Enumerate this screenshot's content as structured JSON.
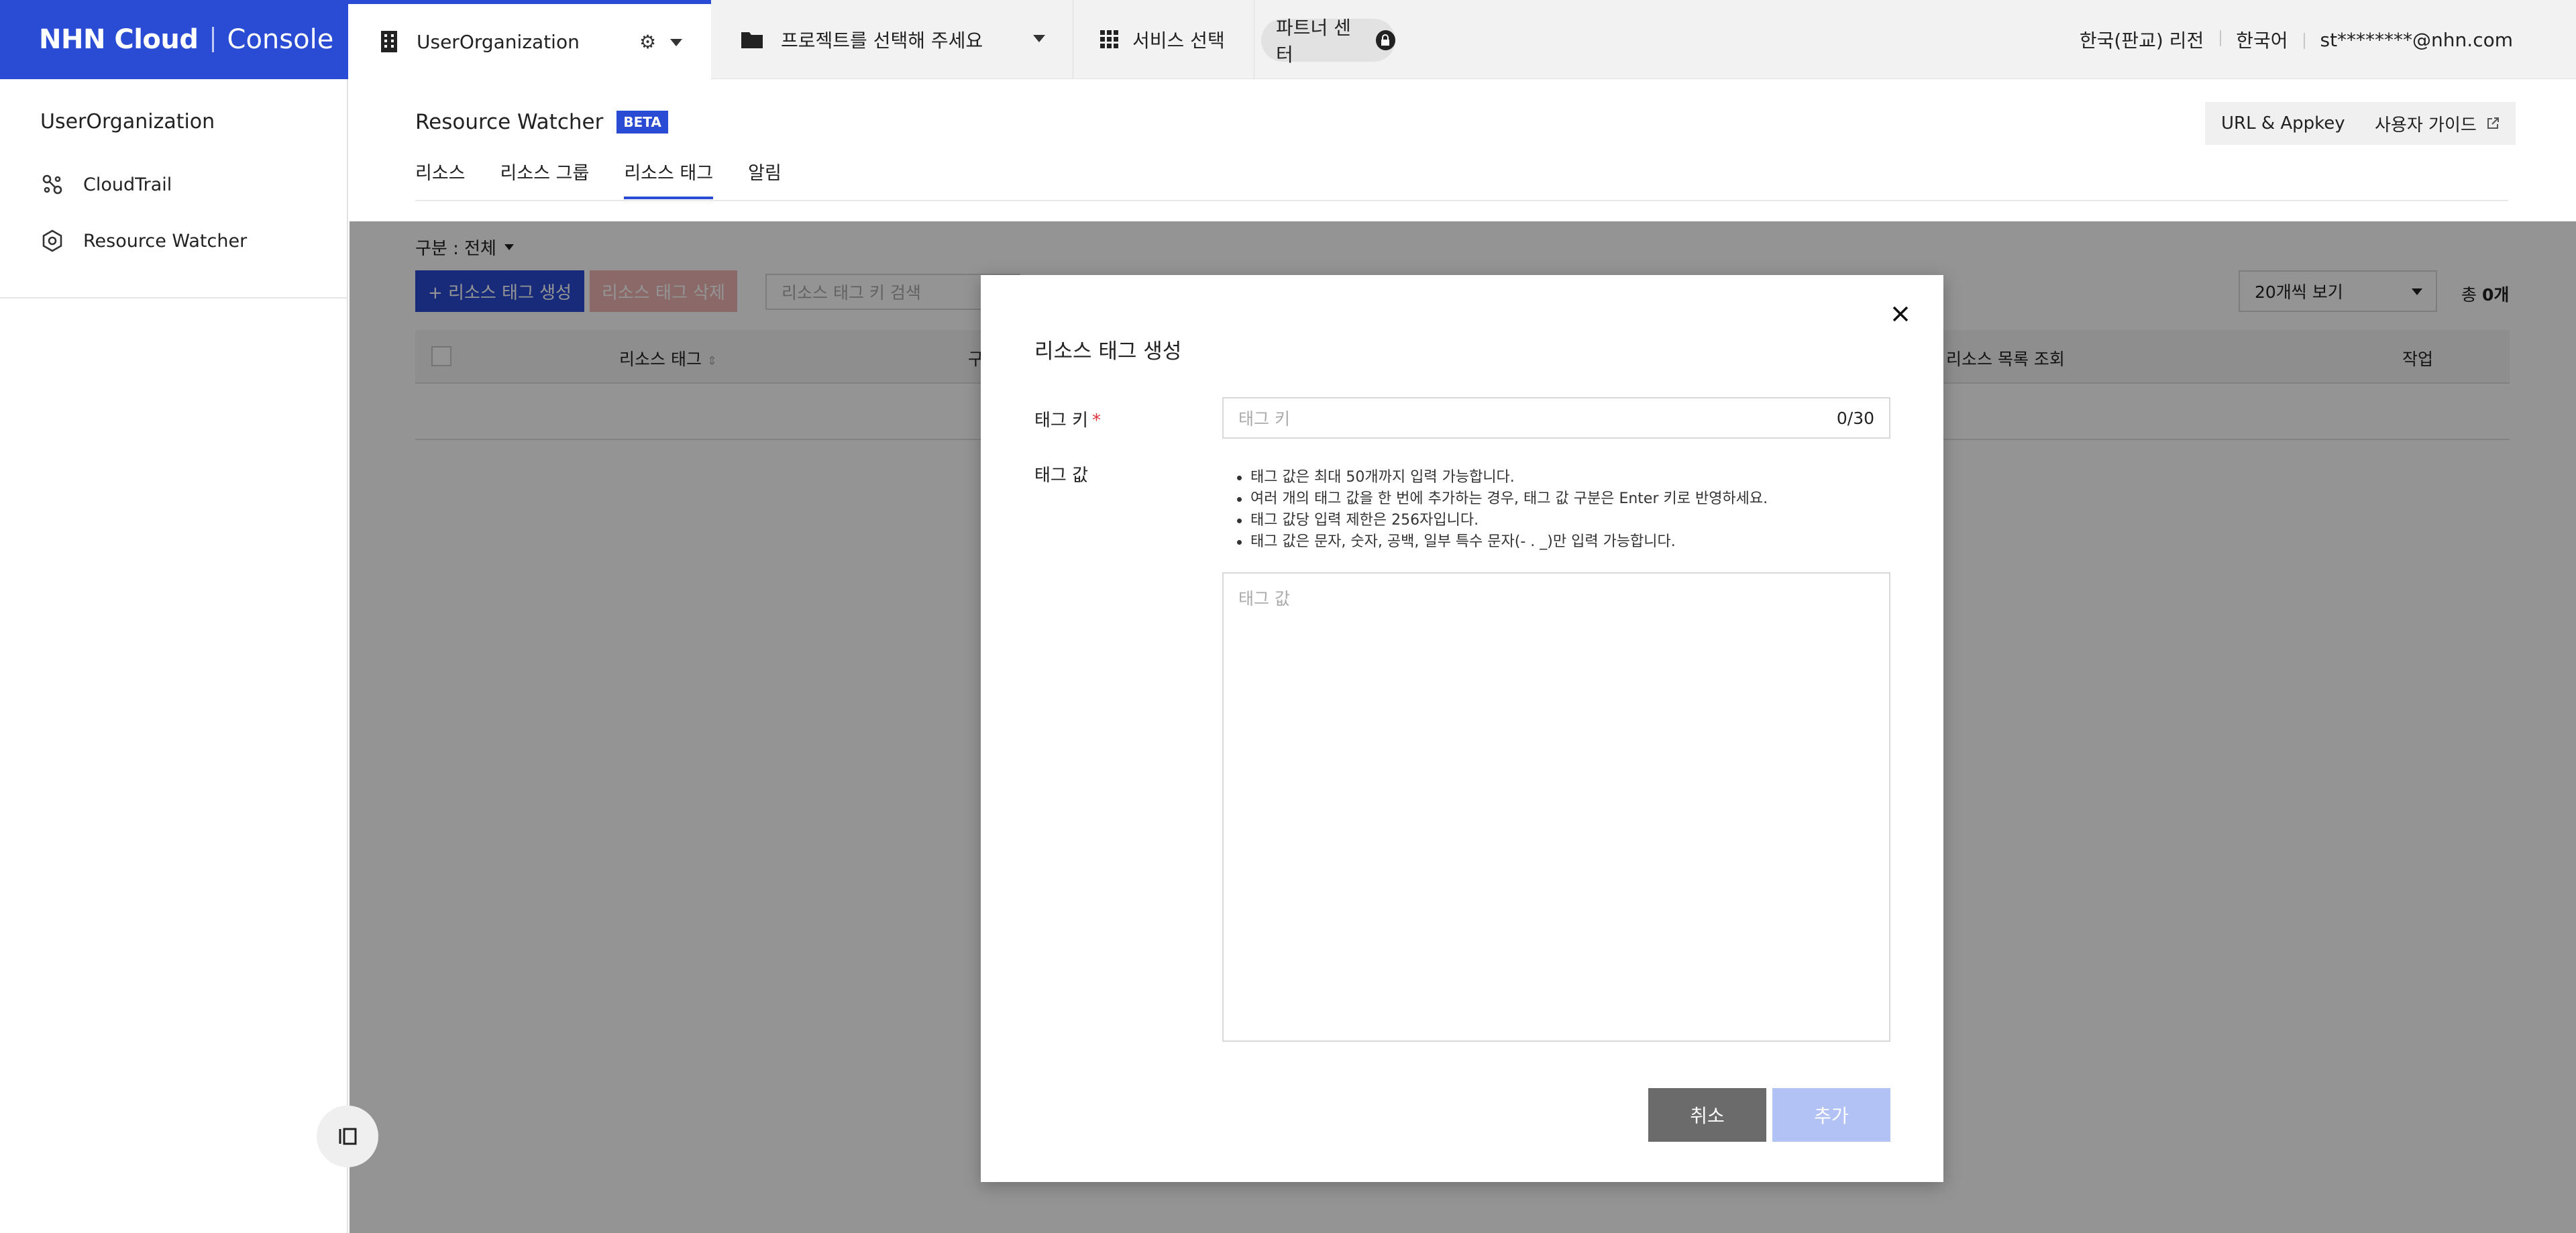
{
  "brand": {
    "logo": "NHN Cloud",
    "console": "Console",
    "color": "#2a4bd3"
  },
  "topbar": {
    "org_name": "UserOrganization",
    "project_placeholder": "프로젝트를 선택해 주세요",
    "service_label": "서비스 선택",
    "partner_label": "파트너 센터",
    "region": "한국(판교) 리전",
    "language": "한국어",
    "user_email": "st********@nhn.com"
  },
  "sidebar": {
    "org_title": "UserOrganization",
    "items": [
      {
        "label": "CloudTrail",
        "icon": "cloudtrail-icon"
      },
      {
        "label": "Resource Watcher",
        "icon": "resource-watcher-icon"
      }
    ]
  },
  "page": {
    "title": "Resource Watcher",
    "badge": "BETA",
    "url_appkey_label": "URL & Appkey",
    "guide_label": "사용자 가이드",
    "tabs": [
      {
        "label": "리소스",
        "active": false
      },
      {
        "label": "리소스 그룹",
        "active": false
      },
      {
        "label": "리소스 태그",
        "active": true
      },
      {
        "label": "알림",
        "active": false
      }
    ]
  },
  "toolbar": {
    "filter_label": "구분 : 전체",
    "create_label": "+ 리소스 태그 생성",
    "delete_label": "리소스 태그 삭제",
    "search_placeholder": "리소스 태그 키 검색",
    "page_size": "20개씩 보기",
    "total_prefix": "총 ",
    "total_value": "0개"
  },
  "table": {
    "headers": [
      "리소스 태그",
      "구",
      "리소스 목록 조회",
      "작업"
    ]
  },
  "modal": {
    "title": "리소스 태그 생성",
    "key_label": "태그 키",
    "key_required": "*",
    "key_placeholder": "태그 키",
    "key_counter": "0/30",
    "value_label": "태그 값",
    "help": [
      "태그 값은 최대 50개까지 입력 가능합니다.",
      "여러 개의 태그 값을 한 번에 추가하는 경우, 태그 값 구분은 Enter 키로 반영하세요.",
      "태그 값당 입력 제한은 256자입니다.",
      "태그 값은 문자, 숫자, 공백, 일부 특수 문자(- . _)만 입력 가능합니다."
    ],
    "value_placeholder": "태그 값",
    "cancel_label": "취소",
    "add_label": "추가"
  }
}
